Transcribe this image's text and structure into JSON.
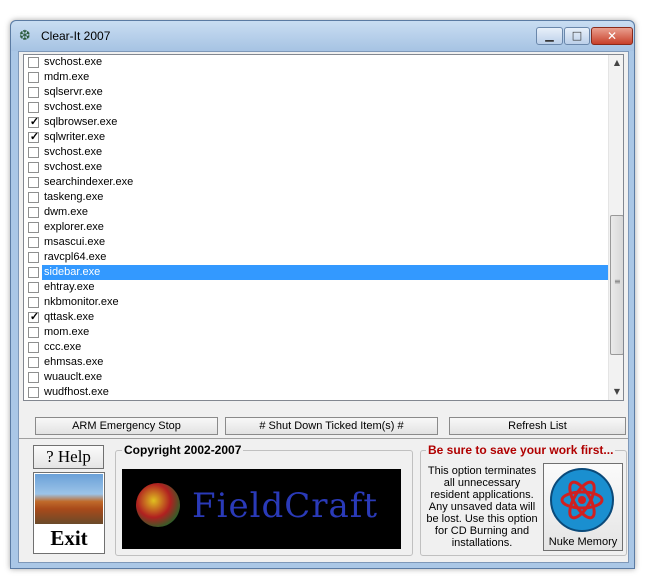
{
  "window": {
    "title": "Clear-It 2007"
  },
  "processes": [
    {
      "name": "svchost.exe",
      "checked": false,
      "selected": false
    },
    {
      "name": "mdm.exe",
      "checked": false,
      "selected": false
    },
    {
      "name": "sqlservr.exe",
      "checked": false,
      "selected": false
    },
    {
      "name": "svchost.exe",
      "checked": false,
      "selected": false
    },
    {
      "name": "sqlbrowser.exe",
      "checked": true,
      "selected": false
    },
    {
      "name": "sqlwriter.exe",
      "checked": true,
      "selected": false
    },
    {
      "name": "svchost.exe",
      "checked": false,
      "selected": false
    },
    {
      "name": "svchost.exe",
      "checked": false,
      "selected": false
    },
    {
      "name": "searchindexer.exe",
      "checked": false,
      "selected": false
    },
    {
      "name": "taskeng.exe",
      "checked": false,
      "selected": false
    },
    {
      "name": "dwm.exe",
      "checked": false,
      "selected": false
    },
    {
      "name": "explorer.exe",
      "checked": false,
      "selected": false
    },
    {
      "name": "msascui.exe",
      "checked": false,
      "selected": false
    },
    {
      "name": "ravcpl64.exe",
      "checked": false,
      "selected": false
    },
    {
      "name": "sidebar.exe",
      "checked": false,
      "selected": true
    },
    {
      "name": "ehtray.exe",
      "checked": false,
      "selected": false
    },
    {
      "name": "nkbmonitor.exe",
      "checked": false,
      "selected": false
    },
    {
      "name": "qttask.exe",
      "checked": true,
      "selected": false
    },
    {
      "name": "mom.exe",
      "checked": false,
      "selected": false
    },
    {
      "name": "ccc.exe",
      "checked": false,
      "selected": false
    },
    {
      "name": "ehmsas.exe",
      "checked": false,
      "selected": false
    },
    {
      "name": "wuauclt.exe",
      "checked": false,
      "selected": false
    },
    {
      "name": "wudfhost.exe",
      "checked": false,
      "selected": false
    }
  ],
  "buttons": {
    "arm": "ARM  Emergency Stop",
    "shutdown": "#   Shut Down Ticked Item(s)   #",
    "refresh": "Refresh List",
    "help": "? Help",
    "exit": "Exit",
    "nuke": "Nuke Memory"
  },
  "copyright": {
    "label": "Copyright 2002-2007",
    "logo_text": "FieldCraft"
  },
  "nuke_panel": {
    "heading": "Be sure to save your work first...",
    "description": "This option terminates all unnecessary resident applications. Any unsaved data will be lost. Use this option for CD Burning and installations."
  },
  "icons": {
    "app": "app-logo-icon",
    "minimize": "minimize-icon",
    "maximize": "maximize-icon",
    "close": "close-icon",
    "nuke": "atom-icon"
  },
  "colors": {
    "selection": "#3399ff",
    "warning": "#b00000",
    "logo_text": "#2a3ab8"
  }
}
